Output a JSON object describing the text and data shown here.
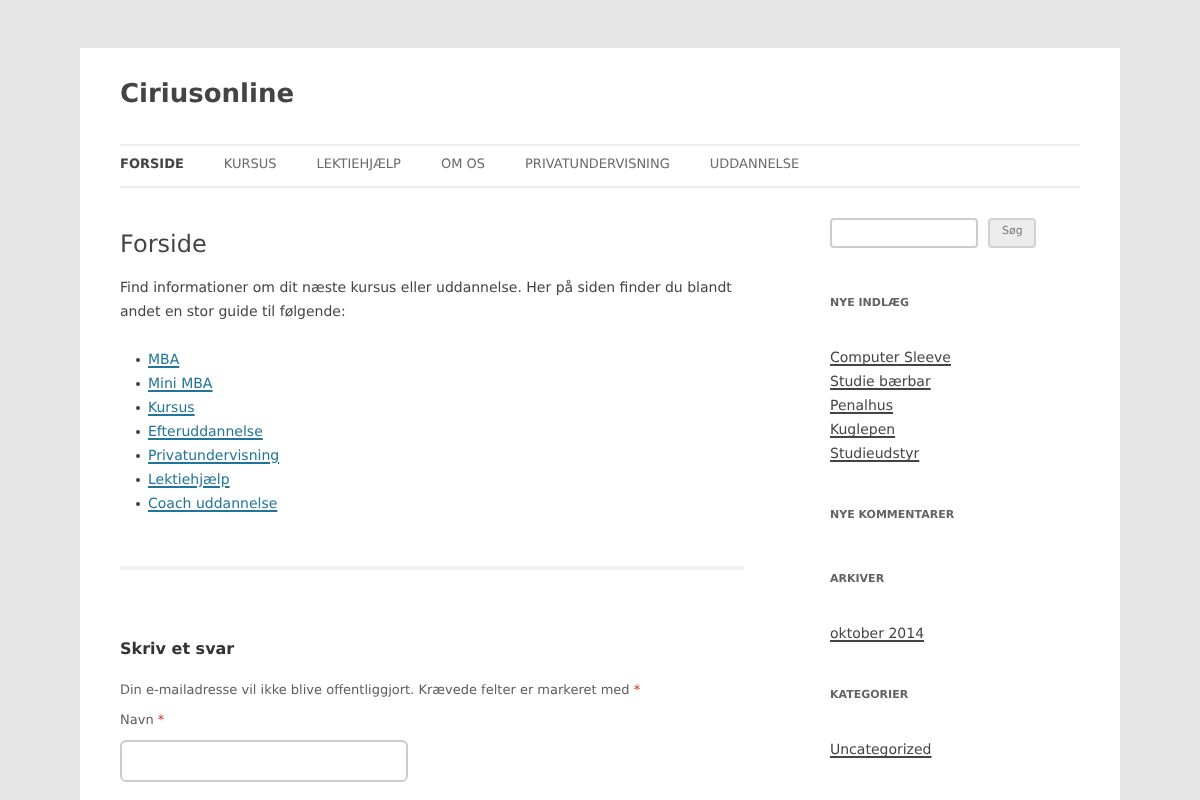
{
  "site_title": "Ciriusonline",
  "nav": [
    {
      "label": "FORSIDE",
      "selected": true
    },
    {
      "label": "KURSUS",
      "selected": false
    },
    {
      "label": "LEKTIEHJÆLP",
      "selected": false
    },
    {
      "label": "OM OS",
      "selected": false
    },
    {
      "label": "PRIVATUNDERVISNING",
      "selected": false
    },
    {
      "label": "UDDANNELSE",
      "selected": false
    }
  ],
  "page": {
    "title": "Forside",
    "intro": "Find informationer om dit næste kursus eller uddannelse. Her på siden finder du blandt andet en stor guide til følgende:",
    "links": [
      "MBA",
      "Mini MBA",
      "Kursus",
      "Efteruddannelse",
      "Privatundervisning",
      "Lektiehjælp",
      "Coach uddannelse"
    ]
  },
  "reply": {
    "title": "Skriv et svar",
    "notice": "Din e-mailadresse vil ikke blive offentliggjort. Krævede felter er markeret med",
    "required_mark": "*",
    "fields": [
      {
        "label": "Navn",
        "required": true
      }
    ]
  },
  "sidebar": {
    "search_button": "Søg",
    "widgets": [
      {
        "title": "NYE INDLÆG",
        "links": [
          "Computer Sleeve",
          "Studie bærbar",
          "Penalhus",
          "Kuglepen",
          "Studieudstyr"
        ]
      },
      {
        "title": "NYE KOMMENTARER"
      },
      {
        "title": "ARKIVER",
        "links": [
          "oktober 2014"
        ]
      },
      {
        "title": "KATEGORIER",
        "links": [
          "Uncategorized"
        ]
      }
    ]
  }
}
